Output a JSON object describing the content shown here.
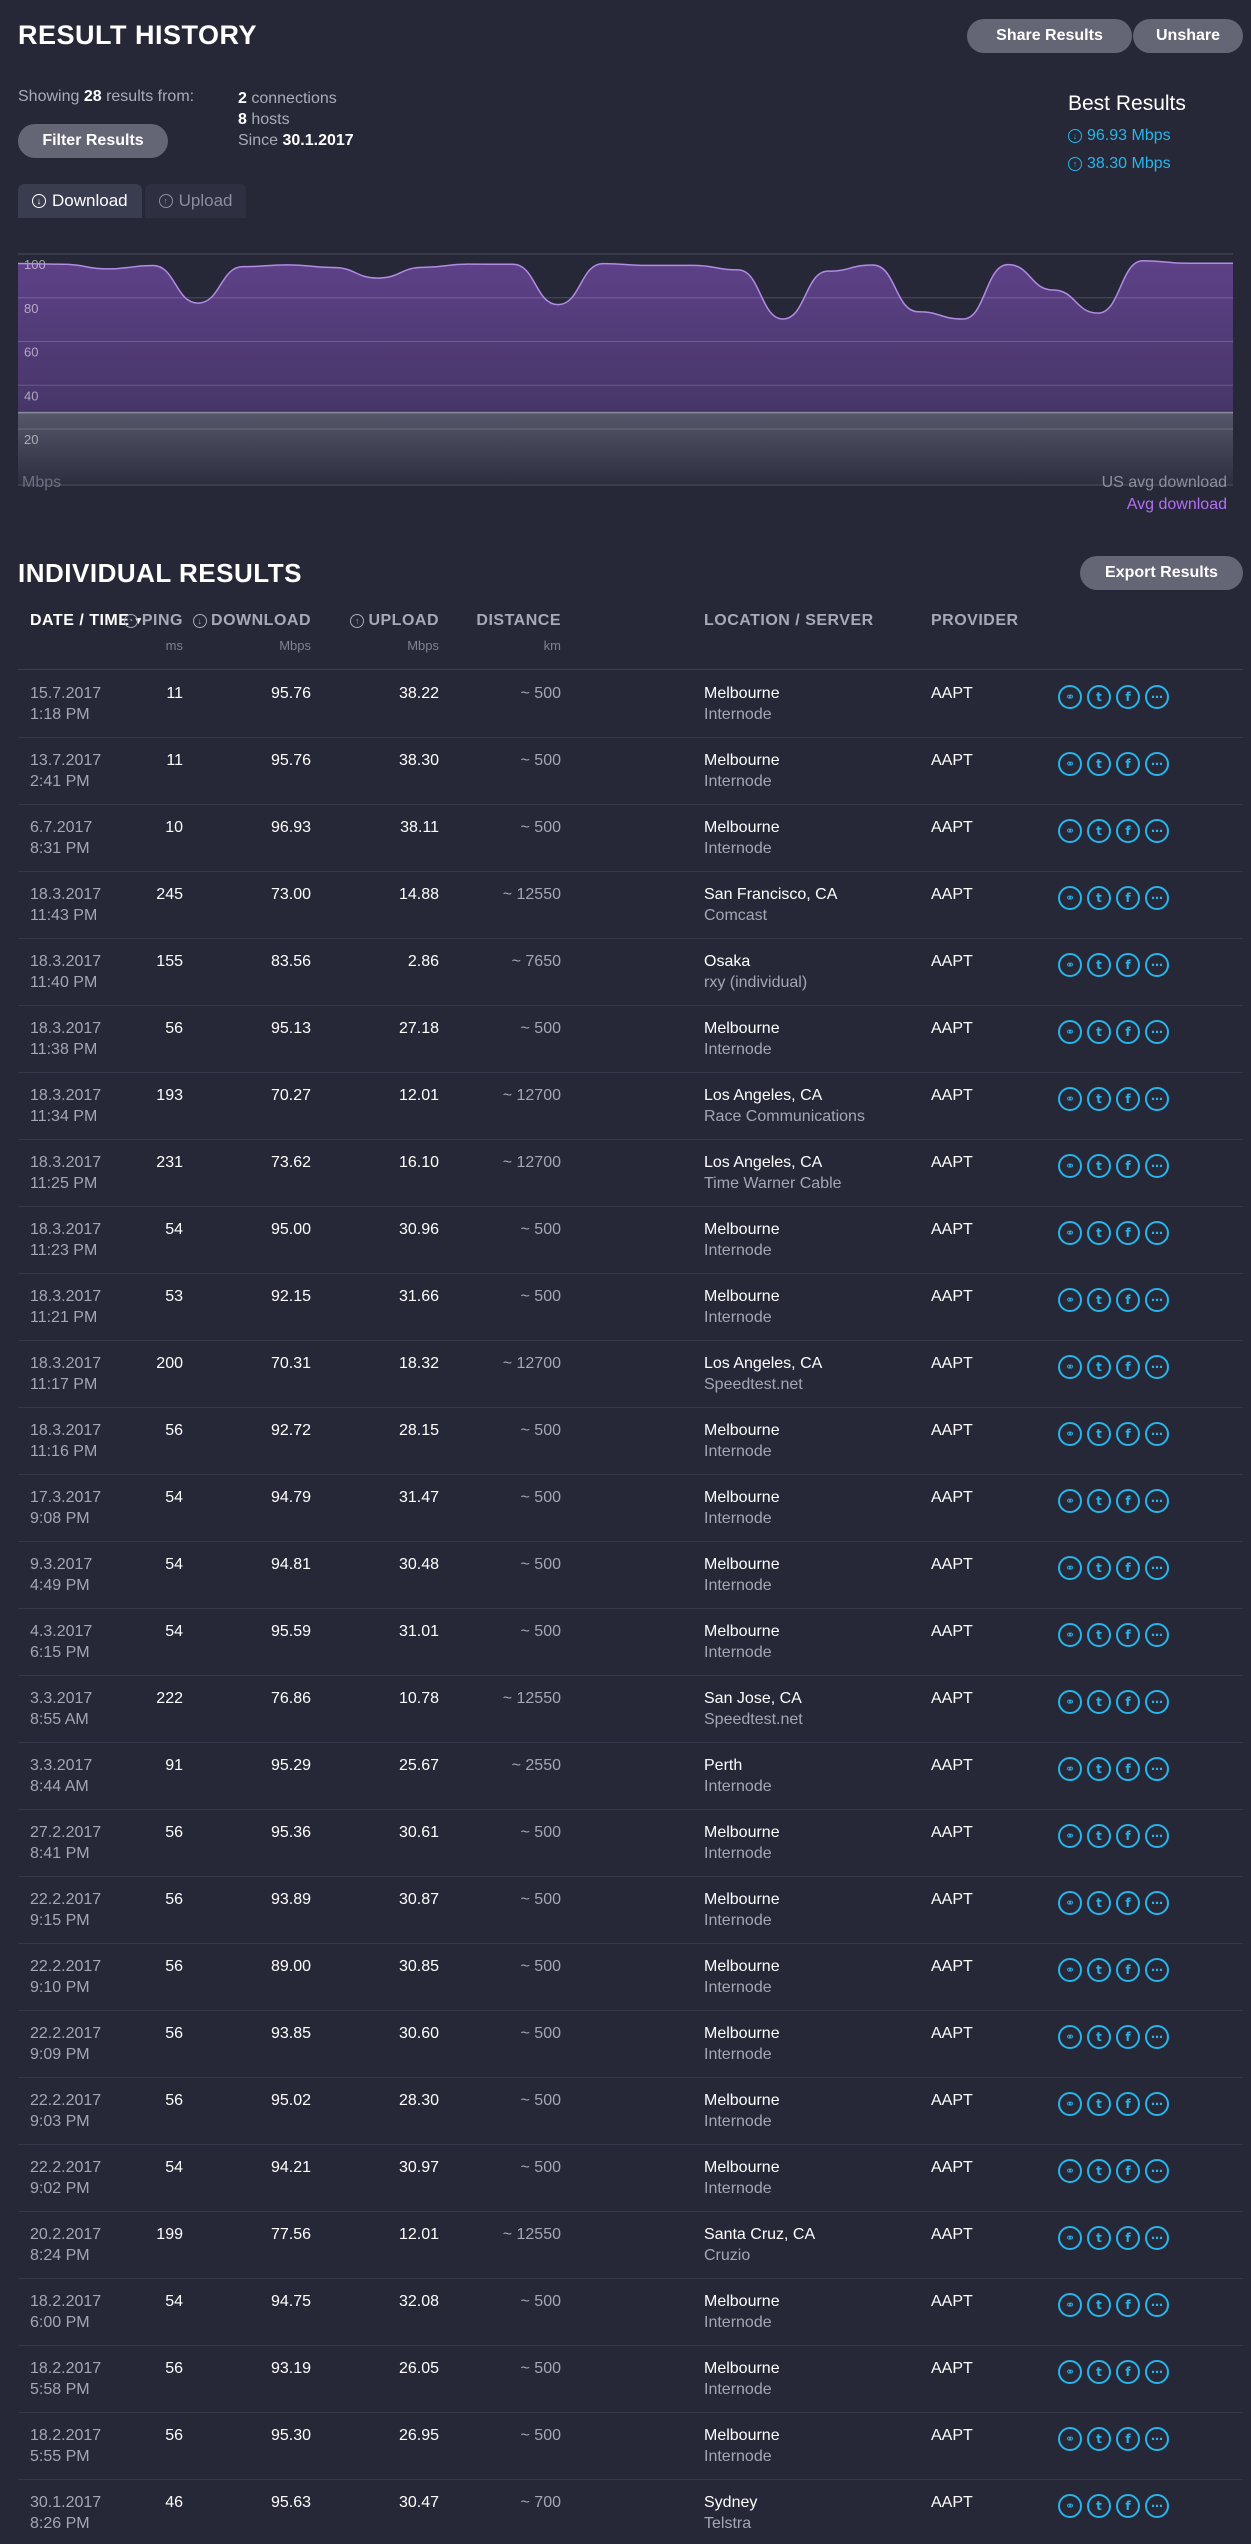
{
  "header": {
    "title": "RESULT HISTORY",
    "share_label": "Share Results",
    "unshare_label": "Unshare"
  },
  "summary": {
    "showing_prefix": "Showing",
    "count": "28",
    "showing_suffix": "results from:",
    "connections_count": "2",
    "connections_label": "connections",
    "hosts_count": "8",
    "hosts_label": "hosts",
    "since_label": "Since",
    "since_date": "30.1.2017",
    "filter_label": "Filter Results"
  },
  "best": {
    "title": "Best Results",
    "download": "96.93 Mbps",
    "upload": "38.30 Mbps"
  },
  "tabs": {
    "download": "Download",
    "upload": "Upload"
  },
  "chart_data": {
    "type": "area",
    "ylabel": "Mbps",
    "yticks": [
      "100",
      "80",
      "60",
      "40",
      "20"
    ],
    "ylim": [
      0,
      100
    ],
    "legend": [
      "US avg download",
      "Avg download"
    ],
    "series": [
      {
        "name": "Avg download",
        "values": [
          95.63,
          95.3,
          93.19,
          94.75,
          77.56,
          94.21,
          95.02,
          93.85,
          89.0,
          93.89,
          95.36,
          95.29,
          76.86,
          95.59,
          94.81,
          94.79,
          92.72,
          70.31,
          92.15,
          95.0,
          73.62,
          70.27,
          95.13,
          83.56,
          73.0,
          96.93,
          95.76,
          95.76
        ]
      }
    ],
    "us_avg_level": 22,
    "colors": {
      "area": "#5b3f86",
      "line": "#b18be4",
      "us_avg": "#4a4c5f"
    }
  },
  "table": {
    "title": "INDIVIDUAL RESULTS",
    "export_label": "Export Results",
    "headers": {
      "date": "DATE / TIME",
      "ping": "PING",
      "ping_unit": "ms",
      "download": "DOWNLOAD",
      "download_unit": "Mbps",
      "upload": "UPLOAD",
      "upload_unit": "Mbps",
      "distance": "DISTANCE",
      "distance_unit": "km",
      "location": "LOCATION / SERVER",
      "provider": "PROVIDER"
    },
    "rows": [
      {
        "date": "15.7.2017",
        "time": "1:18 PM",
        "ping": "11",
        "download": "95.76",
        "upload": "38.22",
        "distance": "~ 500",
        "location": "Melbourne",
        "server": "Internode",
        "provider": "AAPT"
      },
      {
        "date": "13.7.2017",
        "time": "2:41 PM",
        "ping": "11",
        "download": "95.76",
        "upload": "38.30",
        "distance": "~ 500",
        "location": "Melbourne",
        "server": "Internode",
        "provider": "AAPT"
      },
      {
        "date": "6.7.2017",
        "time": "8:31 PM",
        "ping": "10",
        "download": "96.93",
        "upload": "38.11",
        "distance": "~ 500",
        "location": "Melbourne",
        "server": "Internode",
        "provider": "AAPT"
      },
      {
        "date": "18.3.2017",
        "time": "11:43 PM",
        "ping": "245",
        "download": "73.00",
        "upload": "14.88",
        "distance": "~ 12550",
        "location": "San Francisco, CA",
        "server": "Comcast",
        "provider": "AAPT"
      },
      {
        "date": "18.3.2017",
        "time": "11:40 PM",
        "ping": "155",
        "download": "83.56",
        "upload": "2.86",
        "distance": "~ 7650",
        "location": "Osaka",
        "server": "rxy (individual)",
        "provider": "AAPT"
      },
      {
        "date": "18.3.2017",
        "time": "11:38 PM",
        "ping": "56",
        "download": "95.13",
        "upload": "27.18",
        "distance": "~ 500",
        "location": "Melbourne",
        "server": "Internode",
        "provider": "AAPT"
      },
      {
        "date": "18.3.2017",
        "time": "11:34 PM",
        "ping": "193",
        "download": "70.27",
        "upload": "12.01",
        "distance": "~ 12700",
        "location": "Los Angeles, CA",
        "server": "Race Communications",
        "provider": "AAPT"
      },
      {
        "date": "18.3.2017",
        "time": "11:25 PM",
        "ping": "231",
        "download": "73.62",
        "upload": "16.10",
        "distance": "~ 12700",
        "location": "Los Angeles, CA",
        "server": "Time Warner Cable",
        "provider": "AAPT"
      },
      {
        "date": "18.3.2017",
        "time": "11:23 PM",
        "ping": "54",
        "download": "95.00",
        "upload": "30.96",
        "distance": "~ 500",
        "location": "Melbourne",
        "server": "Internode",
        "provider": "AAPT"
      },
      {
        "date": "18.3.2017",
        "time": "11:21 PM",
        "ping": "53",
        "download": "92.15",
        "upload": "31.66",
        "distance": "~ 500",
        "location": "Melbourne",
        "server": "Internode",
        "provider": "AAPT"
      },
      {
        "date": "18.3.2017",
        "time": "11:17 PM",
        "ping": "200",
        "download": "70.31",
        "upload": "18.32",
        "distance": "~ 12700",
        "location": "Los Angeles, CA",
        "server": "Speedtest.net",
        "provider": "AAPT"
      },
      {
        "date": "18.3.2017",
        "time": "11:16 PM",
        "ping": "56",
        "download": "92.72",
        "upload": "28.15",
        "distance": "~ 500",
        "location": "Melbourne",
        "server": "Internode",
        "provider": "AAPT"
      },
      {
        "date": "17.3.2017",
        "time": "9:08 PM",
        "ping": "54",
        "download": "94.79",
        "upload": "31.47",
        "distance": "~ 500",
        "location": "Melbourne",
        "server": "Internode",
        "provider": "AAPT"
      },
      {
        "date": "9.3.2017",
        "time": "4:49 PM",
        "ping": "54",
        "download": "94.81",
        "upload": "30.48",
        "distance": "~ 500",
        "location": "Melbourne",
        "server": "Internode",
        "provider": "AAPT"
      },
      {
        "date": "4.3.2017",
        "time": "6:15 PM",
        "ping": "54",
        "download": "95.59",
        "upload": "31.01",
        "distance": "~ 500",
        "location": "Melbourne",
        "server": "Internode",
        "provider": "AAPT"
      },
      {
        "date": "3.3.2017",
        "time": "8:55 AM",
        "ping": "222",
        "download": "76.86",
        "upload": "10.78",
        "distance": "~ 12550",
        "location": "San Jose, CA",
        "server": "Speedtest.net",
        "provider": "AAPT"
      },
      {
        "date": "3.3.2017",
        "time": "8:44 AM",
        "ping": "91",
        "download": "95.29",
        "upload": "25.67",
        "distance": "~ 2550",
        "location": "Perth",
        "server": "Internode",
        "provider": "AAPT"
      },
      {
        "date": "27.2.2017",
        "time": "8:41 PM",
        "ping": "56",
        "download": "95.36",
        "upload": "30.61",
        "distance": "~ 500",
        "location": "Melbourne",
        "server": "Internode",
        "provider": "AAPT"
      },
      {
        "date": "22.2.2017",
        "time": "9:15 PM",
        "ping": "56",
        "download": "93.89",
        "upload": "30.87",
        "distance": "~ 500",
        "location": "Melbourne",
        "server": "Internode",
        "provider": "AAPT"
      },
      {
        "date": "22.2.2017",
        "time": "9:10 PM",
        "ping": "56",
        "download": "89.00",
        "upload": "30.85",
        "distance": "~ 500",
        "location": "Melbourne",
        "server": "Internode",
        "provider": "AAPT"
      },
      {
        "date": "22.2.2017",
        "time": "9:09 PM",
        "ping": "56",
        "download": "93.85",
        "upload": "30.60",
        "distance": "~ 500",
        "location": "Melbourne",
        "server": "Internode",
        "provider": "AAPT"
      },
      {
        "date": "22.2.2017",
        "time": "9:03 PM",
        "ping": "56",
        "download": "95.02",
        "upload": "28.30",
        "distance": "~ 500",
        "location": "Melbourne",
        "server": "Internode",
        "provider": "AAPT"
      },
      {
        "date": "22.2.2017",
        "time": "9:02 PM",
        "ping": "54",
        "download": "94.21",
        "upload": "30.97",
        "distance": "~ 500",
        "location": "Melbourne",
        "server": "Internode",
        "provider": "AAPT"
      },
      {
        "date": "20.2.2017",
        "time": "8:24 PM",
        "ping": "199",
        "download": "77.56",
        "upload": "12.01",
        "distance": "~ 12550",
        "location": "Santa Cruz, CA",
        "server": "Cruzio",
        "provider": "AAPT"
      },
      {
        "date": "18.2.2017",
        "time": "6:00 PM",
        "ping": "54",
        "download": "94.75",
        "upload": "32.08",
        "distance": "~ 500",
        "location": "Melbourne",
        "server": "Internode",
        "provider": "AAPT"
      },
      {
        "date": "18.2.2017",
        "time": "5:58 PM",
        "ping": "56",
        "download": "93.19",
        "upload": "26.05",
        "distance": "~ 500",
        "location": "Melbourne",
        "server": "Internode",
        "provider": "AAPT"
      },
      {
        "date": "18.2.2017",
        "time": "5:55 PM",
        "ping": "56",
        "download": "95.30",
        "upload": "26.95",
        "distance": "~ 500",
        "location": "Melbourne",
        "server": "Internode",
        "provider": "AAPT"
      },
      {
        "date": "30.1.2017",
        "time": "8:26 PM",
        "ping": "46",
        "download": "95.63",
        "upload": "30.47",
        "distance": "~ 700",
        "location": "Sydney",
        "server": "Telstra",
        "provider": "AAPT"
      }
    ],
    "row_icons": [
      "link-icon",
      "twitter-icon",
      "facebook-icon",
      "more-icon"
    ]
  }
}
